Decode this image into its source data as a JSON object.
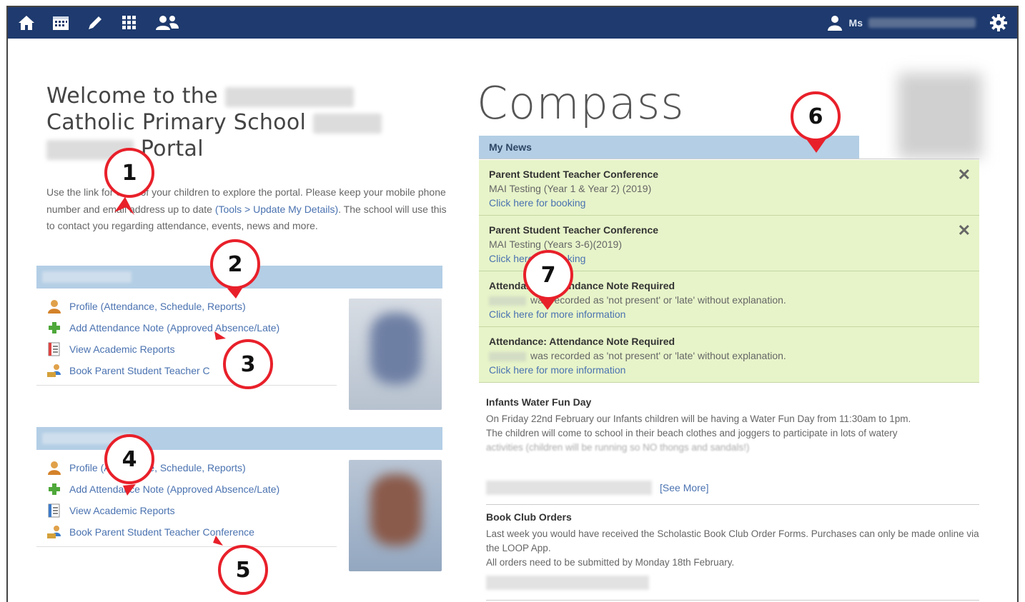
{
  "user": {
    "name": "Ms"
  },
  "welcome": {
    "line1": "Welcome to the",
    "line2": "Catholic Primary School",
    "line3": "Portal"
  },
  "intro": {
    "part1": "Use the link",
    "part2": "for each of your children to explore the portal. Please keep your mobile phone number and email address up to date ",
    "link": "(Tools > Update My Details)",
    "part3": ". The school will use this to contact you regarding attendance, events, news and more."
  },
  "child1": {
    "links": [
      "Profile (Attendance, Schedule, Reports)",
      "Add Attendance Note (Approved Absence/Late)",
      "View Academic Reports",
      "Book Parent Student Teacher C"
    ]
  },
  "child2": {
    "links": [
      "Profile (Attendance, Schedule, Reports)",
      "Add Attendance Note (Approved Absence/Late)",
      "View Academic Reports",
      "Book Parent Student Teacher Conference"
    ]
  },
  "brand": {
    "logo_text": "Compass"
  },
  "news": {
    "header": "My News",
    "alerts": [
      {
        "title": "Parent Student Teacher Conference",
        "sub": "MAI Testing (Year 1 & Year 2) (2019)",
        "link": "Click here for booking",
        "close": "✕"
      },
      {
        "title": "Parent Student Teacher Conference",
        "sub": "MAI Testing (Years 3-6)(2019)",
        "link": "Click here for booking",
        "close": "✕"
      },
      {
        "title": "Attendance: Attendance Note Required",
        "sub": "was recorded as 'not present' or 'late' without explanation.",
        "link": "Click here for more information"
      },
      {
        "title": "Attendance: Attendance Note Required",
        "sub": "was recorded as 'not present' or 'late' without explanation.",
        "link": "Click here for more information"
      }
    ],
    "posts": [
      {
        "title": "Infants Water Fun Day",
        "body1": "On Friday 22nd February our Infants children will be having a Water Fun Day from 11:30am to 1pm.",
        "body2": "The children will come to school in their beach clothes and joggers to participate in lots of watery",
        "body3": "activities (children will be running so NO thongs and sandals!)",
        "more": "[See More]"
      },
      {
        "title": "Book Club Orders",
        "body1": "Last week you would have received the Scholastic Book Club Order Forms.  Purchases can only be made online via the LOOP App.",
        "body2": "All orders need to be submitted by Monday 18th February."
      }
    ]
  },
  "callouts": [
    "1",
    "2",
    "3",
    "4",
    "5",
    "6",
    "7"
  ],
  "colors": {
    "navbar": "#1e3a6e",
    "panel_header": "#b3cee5",
    "alert_bg": "#e7f4c9",
    "callout": "#e8202a",
    "link": "#4a72b0"
  }
}
